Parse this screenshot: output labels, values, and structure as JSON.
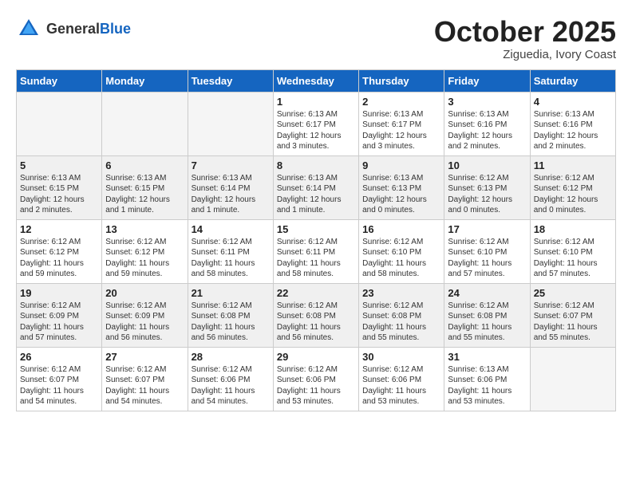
{
  "header": {
    "logo_general": "General",
    "logo_blue": "Blue",
    "month": "October 2025",
    "location": "Ziguedia, Ivory Coast"
  },
  "weekdays": [
    "Sunday",
    "Monday",
    "Tuesday",
    "Wednesday",
    "Thursday",
    "Friday",
    "Saturday"
  ],
  "weeks": [
    [
      {
        "day": "",
        "empty": true
      },
      {
        "day": "",
        "empty": true
      },
      {
        "day": "",
        "empty": true
      },
      {
        "day": "1",
        "sunrise": "Sunrise: 6:13 AM",
        "sunset": "Sunset: 6:17 PM",
        "daylight": "Daylight: 12 hours and 3 minutes."
      },
      {
        "day": "2",
        "sunrise": "Sunrise: 6:13 AM",
        "sunset": "Sunset: 6:17 PM",
        "daylight": "Daylight: 12 hours and 3 minutes."
      },
      {
        "day": "3",
        "sunrise": "Sunrise: 6:13 AM",
        "sunset": "Sunset: 6:16 PM",
        "daylight": "Daylight: 12 hours and 2 minutes."
      },
      {
        "day": "4",
        "sunrise": "Sunrise: 6:13 AM",
        "sunset": "Sunset: 6:16 PM",
        "daylight": "Daylight: 12 hours and 2 minutes."
      }
    ],
    [
      {
        "day": "5",
        "sunrise": "Sunrise: 6:13 AM",
        "sunset": "Sunset: 6:15 PM",
        "daylight": "Daylight: 12 hours and 2 minutes."
      },
      {
        "day": "6",
        "sunrise": "Sunrise: 6:13 AM",
        "sunset": "Sunset: 6:15 PM",
        "daylight": "Daylight: 12 hours and 1 minute."
      },
      {
        "day": "7",
        "sunrise": "Sunrise: 6:13 AM",
        "sunset": "Sunset: 6:14 PM",
        "daylight": "Daylight: 12 hours and 1 minute."
      },
      {
        "day": "8",
        "sunrise": "Sunrise: 6:13 AM",
        "sunset": "Sunset: 6:14 PM",
        "daylight": "Daylight: 12 hours and 1 minute."
      },
      {
        "day": "9",
        "sunrise": "Sunrise: 6:13 AM",
        "sunset": "Sunset: 6:13 PM",
        "daylight": "Daylight: 12 hours and 0 minutes."
      },
      {
        "day": "10",
        "sunrise": "Sunrise: 6:12 AM",
        "sunset": "Sunset: 6:13 PM",
        "daylight": "Daylight: 12 hours and 0 minutes."
      },
      {
        "day": "11",
        "sunrise": "Sunrise: 6:12 AM",
        "sunset": "Sunset: 6:12 PM",
        "daylight": "Daylight: 12 hours and 0 minutes."
      }
    ],
    [
      {
        "day": "12",
        "sunrise": "Sunrise: 6:12 AM",
        "sunset": "Sunset: 6:12 PM",
        "daylight": "Daylight: 11 hours and 59 minutes."
      },
      {
        "day": "13",
        "sunrise": "Sunrise: 6:12 AM",
        "sunset": "Sunset: 6:12 PM",
        "daylight": "Daylight: 11 hours and 59 minutes."
      },
      {
        "day": "14",
        "sunrise": "Sunrise: 6:12 AM",
        "sunset": "Sunset: 6:11 PM",
        "daylight": "Daylight: 11 hours and 58 minutes."
      },
      {
        "day": "15",
        "sunrise": "Sunrise: 6:12 AM",
        "sunset": "Sunset: 6:11 PM",
        "daylight": "Daylight: 11 hours and 58 minutes."
      },
      {
        "day": "16",
        "sunrise": "Sunrise: 6:12 AM",
        "sunset": "Sunset: 6:10 PM",
        "daylight": "Daylight: 11 hours and 58 minutes."
      },
      {
        "day": "17",
        "sunrise": "Sunrise: 6:12 AM",
        "sunset": "Sunset: 6:10 PM",
        "daylight": "Daylight: 11 hours and 57 minutes."
      },
      {
        "day": "18",
        "sunrise": "Sunrise: 6:12 AM",
        "sunset": "Sunset: 6:10 PM",
        "daylight": "Daylight: 11 hours and 57 minutes."
      }
    ],
    [
      {
        "day": "19",
        "sunrise": "Sunrise: 6:12 AM",
        "sunset": "Sunset: 6:09 PM",
        "daylight": "Daylight: 11 hours and 57 minutes."
      },
      {
        "day": "20",
        "sunrise": "Sunrise: 6:12 AM",
        "sunset": "Sunset: 6:09 PM",
        "daylight": "Daylight: 11 hours and 56 minutes."
      },
      {
        "day": "21",
        "sunrise": "Sunrise: 6:12 AM",
        "sunset": "Sunset: 6:08 PM",
        "daylight": "Daylight: 11 hours and 56 minutes."
      },
      {
        "day": "22",
        "sunrise": "Sunrise: 6:12 AM",
        "sunset": "Sunset: 6:08 PM",
        "daylight": "Daylight: 11 hours and 56 minutes."
      },
      {
        "day": "23",
        "sunrise": "Sunrise: 6:12 AM",
        "sunset": "Sunset: 6:08 PM",
        "daylight": "Daylight: 11 hours and 55 minutes."
      },
      {
        "day": "24",
        "sunrise": "Sunrise: 6:12 AM",
        "sunset": "Sunset: 6:08 PM",
        "daylight": "Daylight: 11 hours and 55 minutes."
      },
      {
        "day": "25",
        "sunrise": "Sunrise: 6:12 AM",
        "sunset": "Sunset: 6:07 PM",
        "daylight": "Daylight: 11 hours and 55 minutes."
      }
    ],
    [
      {
        "day": "26",
        "sunrise": "Sunrise: 6:12 AM",
        "sunset": "Sunset: 6:07 PM",
        "daylight": "Daylight: 11 hours and 54 minutes."
      },
      {
        "day": "27",
        "sunrise": "Sunrise: 6:12 AM",
        "sunset": "Sunset: 6:07 PM",
        "daylight": "Daylight: 11 hours and 54 minutes."
      },
      {
        "day": "28",
        "sunrise": "Sunrise: 6:12 AM",
        "sunset": "Sunset: 6:06 PM",
        "daylight": "Daylight: 11 hours and 54 minutes."
      },
      {
        "day": "29",
        "sunrise": "Sunrise: 6:12 AM",
        "sunset": "Sunset: 6:06 PM",
        "daylight": "Daylight: 11 hours and 53 minutes."
      },
      {
        "day": "30",
        "sunrise": "Sunrise: 6:12 AM",
        "sunset": "Sunset: 6:06 PM",
        "daylight": "Daylight: 11 hours and 53 minutes."
      },
      {
        "day": "31",
        "sunrise": "Sunrise: 6:13 AM",
        "sunset": "Sunset: 6:06 PM",
        "daylight": "Daylight: 11 hours and 53 minutes."
      },
      {
        "day": "",
        "empty": true
      }
    ]
  ]
}
